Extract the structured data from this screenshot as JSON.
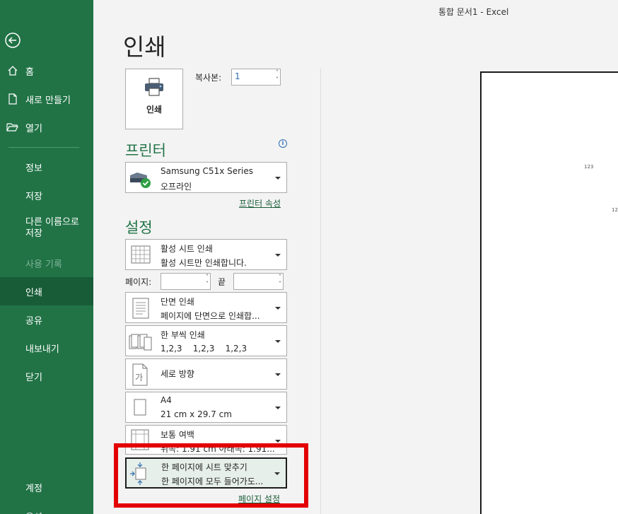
{
  "window": {
    "title": "통합 문서1  -  Excel"
  },
  "sidebar": {
    "items": [
      {
        "label": "홈",
        "icon": "home-icon"
      },
      {
        "label": "새로 만들기",
        "icon": "new-file-icon"
      },
      {
        "label": "열기",
        "icon": "open-folder-icon"
      },
      {
        "label": "정보"
      },
      {
        "label": "저장"
      },
      {
        "label": "다른 이름으로 저장"
      },
      {
        "label": "사용 기록"
      },
      {
        "label": "인쇄"
      },
      {
        "label": "공유"
      },
      {
        "label": "내보내기"
      },
      {
        "label": "닫기"
      },
      {
        "label": "계정"
      },
      {
        "label": "옵션"
      }
    ]
  },
  "page": {
    "title": "인쇄"
  },
  "print": {
    "button_label": "인쇄",
    "copies_label": "복사본:",
    "copies_value": "1"
  },
  "printer": {
    "section_title": "프린터",
    "info_glyph": "i",
    "name": "Samsung C51x Series",
    "status": "오프라인",
    "properties_link": "프린터 속성"
  },
  "settings": {
    "section_title": "설정",
    "print_what": {
      "line1": "활성 시트 인쇄",
      "line2": "활성 시트만 인쇄합니다."
    },
    "pages_label": "페이지:",
    "to_label": "끝",
    "sides": {
      "line1": "단면 인쇄",
      "line2": "페이지에 단면으로 인쇄합..."
    },
    "collate": {
      "line1": "한 부씩 인쇄",
      "line2": "1,2,3    1,2,3    1,2,3"
    },
    "orientation": {
      "line1": "세로 방향"
    },
    "paper": {
      "line1": "A4",
      "line2": "21 cm x 29.7 cm"
    },
    "margins": {
      "line1": "보통 여백",
      "line2": "위쪽: 1.91 cm 아래쪽: 1.91..."
    },
    "scaling": {
      "line1": "한 페이지에 시트 맞추기",
      "line2": "한 페이지에 모두 들어가도..."
    },
    "page_setup_link": "페이지 설정"
  },
  "preview": {
    "cell1": "123",
    "cell2": "12"
  },
  "colors": {
    "accent": "#217346",
    "active_nav": "#185c37",
    "highlight": "#e30000"
  }
}
